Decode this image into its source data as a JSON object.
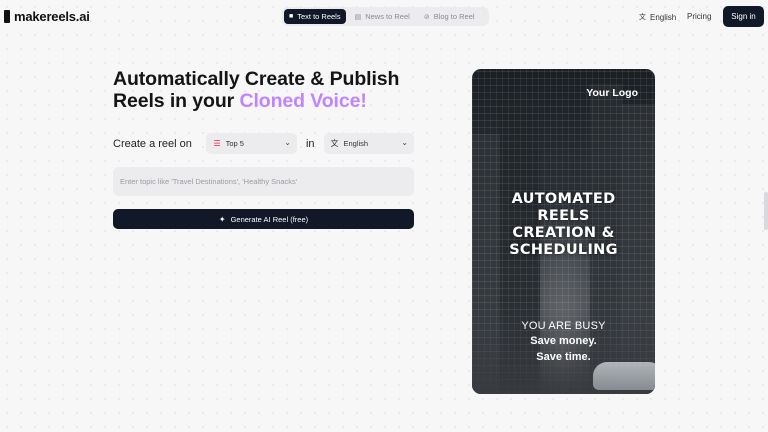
{
  "brand": {
    "name": "makereels.ai"
  },
  "nav": {
    "tabs": [
      {
        "label": "Text to Reels",
        "icon": "video-icon",
        "active": true
      },
      {
        "label": "News to Reel",
        "icon": "news-icon",
        "active": false
      },
      {
        "label": "Blog to Reel",
        "icon": "link-icon",
        "active": false
      }
    ],
    "language": "English",
    "pricing": "Pricing",
    "signin": "Sign in"
  },
  "hero": {
    "title_line1": "Automatically Create & Publish",
    "title_line2_prefix": "Reels in your ",
    "title_accent": "Cloned Voice!",
    "accent_color": "#c084fc"
  },
  "form": {
    "create_label": "Create a reel on",
    "topic_select": "Top 5",
    "in_label": "in",
    "language_select": "English",
    "topic_placeholder": "Enter topic like 'Travel Destinations', 'Healthy Snacks'",
    "generate_label": "Generate AI Reel (free)"
  },
  "preview": {
    "logo": "Your Logo",
    "headline": [
      "AUTOMATED",
      "REELS",
      "CREATION &",
      "SCHEDULING"
    ],
    "sub1": "YOU ARE BUSY",
    "sub2": "Save money.",
    "sub3": "Save time."
  },
  "colors": {
    "primary": "#111827",
    "background": "#f7f7f8",
    "pill": "#ececef"
  }
}
